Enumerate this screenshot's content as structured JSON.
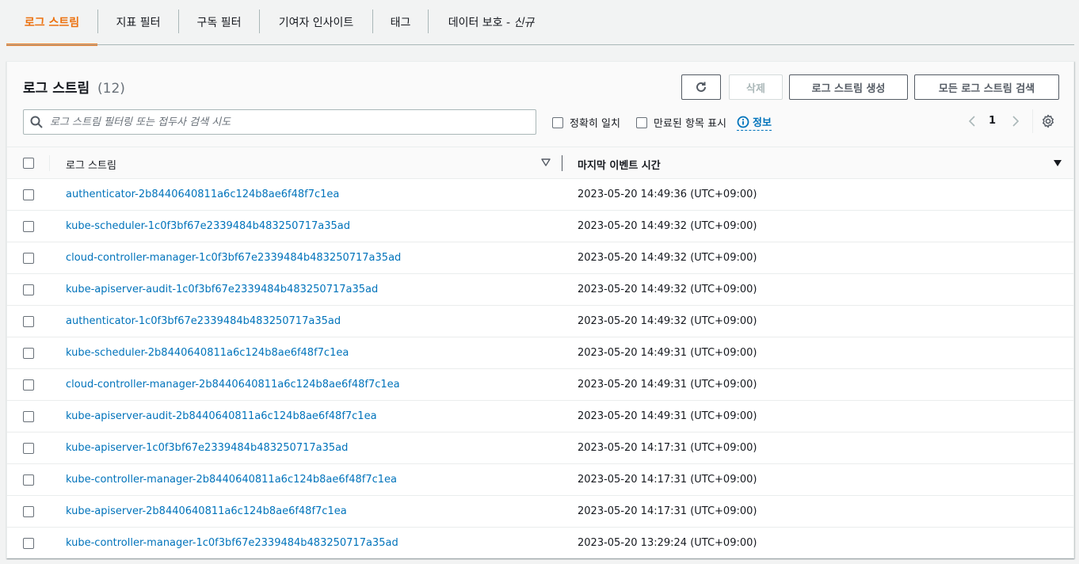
{
  "tabs": [
    {
      "label": "로그 스트림",
      "active": true
    },
    {
      "label": "지표 필터",
      "active": false
    },
    {
      "label": "구독 필터",
      "active": false
    },
    {
      "label": "기여자 인사이트",
      "active": false
    },
    {
      "label": "태그",
      "active": false
    },
    {
      "label": "데이터 보호 - ",
      "label_italic": "신규",
      "active": false
    }
  ],
  "header": {
    "title": "로그 스트림",
    "count": "(12)",
    "refresh_icon": "refresh-icon",
    "delete_label": "삭제",
    "create_label": "로그 스트림 생성",
    "search_all_label": "모든 로그 스트림 검색"
  },
  "search": {
    "placeholder": "로그 스트림 필터링 또는 접두사 검색 시도",
    "value": ""
  },
  "options": {
    "exact_match": "정확히 일치",
    "show_expired": "만료된 항목 표시",
    "info": "정보"
  },
  "pagination": {
    "page": "1"
  },
  "table": {
    "columns": {
      "name": "로그 스트림",
      "time": "마지막 이벤트 시간"
    },
    "rows": [
      {
        "name": "authenticator-2b8440640811a6c124b8ae6f48f7c1ea",
        "time": "2023-05-20 14:49:36 (UTC+09:00)"
      },
      {
        "name": "kube-scheduler-1c0f3bf67e2339484b483250717a35ad",
        "time": "2023-05-20 14:49:32 (UTC+09:00)"
      },
      {
        "name": "cloud-controller-manager-1c0f3bf67e2339484b483250717a35ad",
        "time": "2023-05-20 14:49:32 (UTC+09:00)"
      },
      {
        "name": "kube-apiserver-audit-1c0f3bf67e2339484b483250717a35ad",
        "time": "2023-05-20 14:49:32 (UTC+09:00)"
      },
      {
        "name": "authenticator-1c0f3bf67e2339484b483250717a35ad",
        "time": "2023-05-20 14:49:32 (UTC+09:00)"
      },
      {
        "name": "kube-scheduler-2b8440640811a6c124b8ae6f48f7c1ea",
        "time": "2023-05-20 14:49:31 (UTC+09:00)"
      },
      {
        "name": "cloud-controller-manager-2b8440640811a6c124b8ae6f48f7c1ea",
        "time": "2023-05-20 14:49:31 (UTC+09:00)"
      },
      {
        "name": "kube-apiserver-audit-2b8440640811a6c124b8ae6f48f7c1ea",
        "time": "2023-05-20 14:49:31 (UTC+09:00)"
      },
      {
        "name": "kube-apiserver-1c0f3bf67e2339484b483250717a35ad",
        "time": "2023-05-20 14:17:31 (UTC+09:00)"
      },
      {
        "name": "kube-controller-manager-2b8440640811a6c124b8ae6f48f7c1ea",
        "time": "2023-05-20 14:17:31 (UTC+09:00)"
      },
      {
        "name": "kube-apiserver-2b8440640811a6c124b8ae6f48f7c1ea",
        "time": "2023-05-20 14:17:31 (UTC+09:00)"
      },
      {
        "name": "kube-controller-manager-1c0f3bf67e2339484b483250717a35ad",
        "time": "2023-05-20 13:29:24 (UTC+09:00)"
      }
    ]
  },
  "colors": {
    "accent": "#ec7211",
    "link": "#0073bb"
  }
}
